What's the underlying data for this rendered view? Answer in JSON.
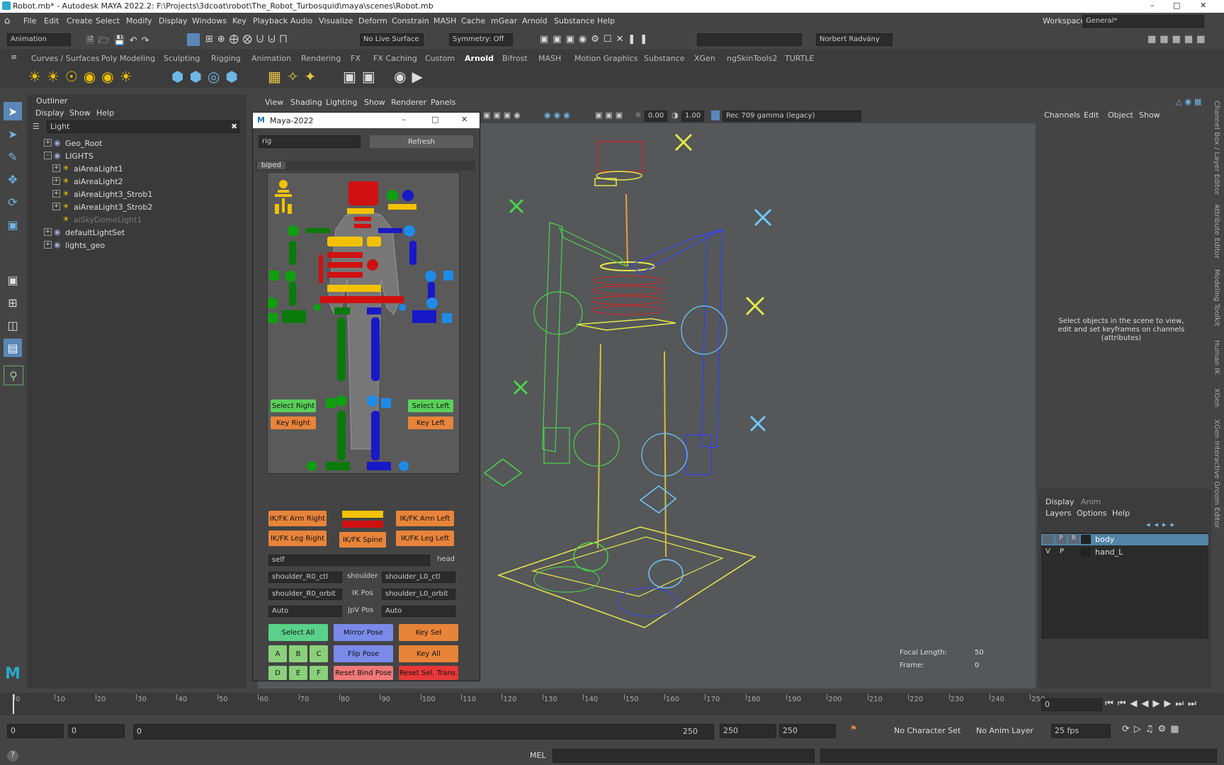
{
  "window": {
    "title": "Robot.mb* - Autodesk MAYA 2022.2: F:\\Projects\\3dcoat\\robot\\The_Robot_Turbosquid\\maya\\scenes\\Robot.mb",
    "workspace_label": "Workspace:",
    "workspace_value": "General*"
  },
  "menubar": [
    "File",
    "Edit",
    "Create",
    "Select",
    "Modify",
    "Display",
    "Windows",
    "Key",
    "Playback",
    "Audio",
    "Visualize",
    "Deform",
    "Constrain",
    "MASH",
    "Cache",
    "mGear",
    "Arnold",
    "Substance",
    "Help"
  ],
  "statusline": {
    "mode": "Animation",
    "live_surface": "No Live Surface",
    "symmetry": "Symmetry: Off",
    "user": "Norbert Radvány"
  },
  "shelf_tabs": [
    "Curves / Surfaces",
    "Poly Modeling",
    "Sculpting",
    "Rigging",
    "Animation",
    "Rendering",
    "FX",
    "FX Caching",
    "Custom",
    "Arnold",
    "Bifrost",
    "MASH",
    "Motion Graphics",
    "Substance",
    "XGen",
    "ngSkinTools2",
    "TURTLE"
  ],
  "shelf_active": "Arnold",
  "outliner": {
    "title": "Outliner",
    "menus": [
      "Display",
      "Show",
      "Help"
    ],
    "search": "Light",
    "items": [
      {
        "label": "Geo_Root",
        "indent": 0,
        "expand": "+"
      },
      {
        "label": "LIGHTS",
        "indent": 0,
        "expand": "-"
      },
      {
        "label": "aiAreaLight1",
        "indent": 1,
        "expand": "+"
      },
      {
        "label": "aiAreaLight2",
        "indent": 1,
        "expand": "+"
      },
      {
        "label": "aiAreaLight3_Strob1",
        "indent": 1,
        "expand": "+"
      },
      {
        "label": "aiAreaLight3_Strob2",
        "indent": 1,
        "expand": "+"
      },
      {
        "label": "aiSkyDomeLight1",
        "indent": 1,
        "expand": "",
        "dim": true
      },
      {
        "label": "defaultLightSet",
        "indent": 0,
        "expand": "+"
      },
      {
        "label": "lights_geo",
        "indent": 0,
        "expand": "+"
      }
    ]
  },
  "viewport": {
    "menus": [
      "View",
      "Shading",
      "Lighting",
      "Show",
      "Renderer",
      "Panels"
    ],
    "exposure": "0.00",
    "gamma": "1.00",
    "color_space": "Rec 709 gamma (legacy)",
    "hud_focal_label": "Focal Length:",
    "hud_focal_value": "50",
    "hud_frame_label": "Frame:",
    "hud_frame_value": "0"
  },
  "picker": {
    "title": "Maya-2022",
    "rig_combo": "rig",
    "refresh": "Refresh",
    "tab": "biped",
    "select_right": "Select Right",
    "select_left": "Select Left",
    "key_right": "Key Right",
    "key_left": "Key Left",
    "ikfk_arm_right": "IK/FK Arm Right",
    "ikfk_arm_left": "IK/FK Arm Left",
    "ikfk_leg_right": "IK/FK Leg Right",
    "ikfk_leg_left": "IK/FK Leg Left",
    "ikfk_spine": "IK/FK Spine",
    "space_combo": "self",
    "space_label": "head",
    "shoulder_r": "shoulder_R0_ctl",
    "shoulder_label": "shoulder",
    "shoulder_l": "shoulder_L0_ctl",
    "orbit_r": "shoulder_R0_orbit",
    "ikpos_label": "IK Pos",
    "orbit_l": "shoulder_L0_orbit",
    "auto_r": "Auto",
    "jpv_label": "JpV Pos",
    "auto_l": "Auto",
    "select_all": "Select All",
    "mirror_pose": "Mirror Pose",
    "key_sel": "Key Sel",
    "flip_pose": "Flip Pose",
    "key_all": "Key All",
    "reset_bind": "Reset Bind Pose",
    "reset_sel": "Reset Sel. Trans.",
    "letters": [
      "A",
      "B",
      "C",
      "D",
      "E",
      "F"
    ]
  },
  "channelbox": {
    "menus": [
      "Channels",
      "Edit",
      "Object",
      "Show"
    ],
    "hint": "Select objects in the scene to view, edit and set keyframes on channels (attributes)",
    "tabs": [
      "Display",
      "Anim"
    ],
    "layer_menus": [
      "Layers",
      "Options",
      "Help"
    ],
    "layers": [
      {
        "v": "",
        "p": "P",
        "r": "R",
        "name": "body",
        "selected": true
      },
      {
        "v": "V",
        "p": "P",
        "r": "",
        "name": "hand_L",
        "selected": false
      }
    ],
    "side_tabs": [
      "Channel Box / Layer Editor",
      "Attribute Editor",
      "Modeling Toolkit",
      "Human IK",
      "XGen",
      "XGen Interactive Groom Editor"
    ]
  },
  "timeline": {
    "ticks": [
      "0",
      "10",
      "20",
      "30",
      "40",
      "50",
      "60",
      "70",
      "80",
      "90",
      "100",
      "110",
      "120",
      "130",
      "140",
      "150",
      "160",
      "170",
      "180",
      "190",
      "200",
      "210",
      "220",
      "230",
      "240",
      "250"
    ],
    "current_frame": "0"
  },
  "range": {
    "start": "0",
    "inner_start": "0",
    "slider_start": "0",
    "slider_end": "250",
    "inner_end": "250",
    "end": "250",
    "character_set": "No Character Set",
    "anim_layer": "No Anim Layer",
    "fps": "25 fps"
  },
  "cmdline": {
    "lang": "MEL"
  }
}
